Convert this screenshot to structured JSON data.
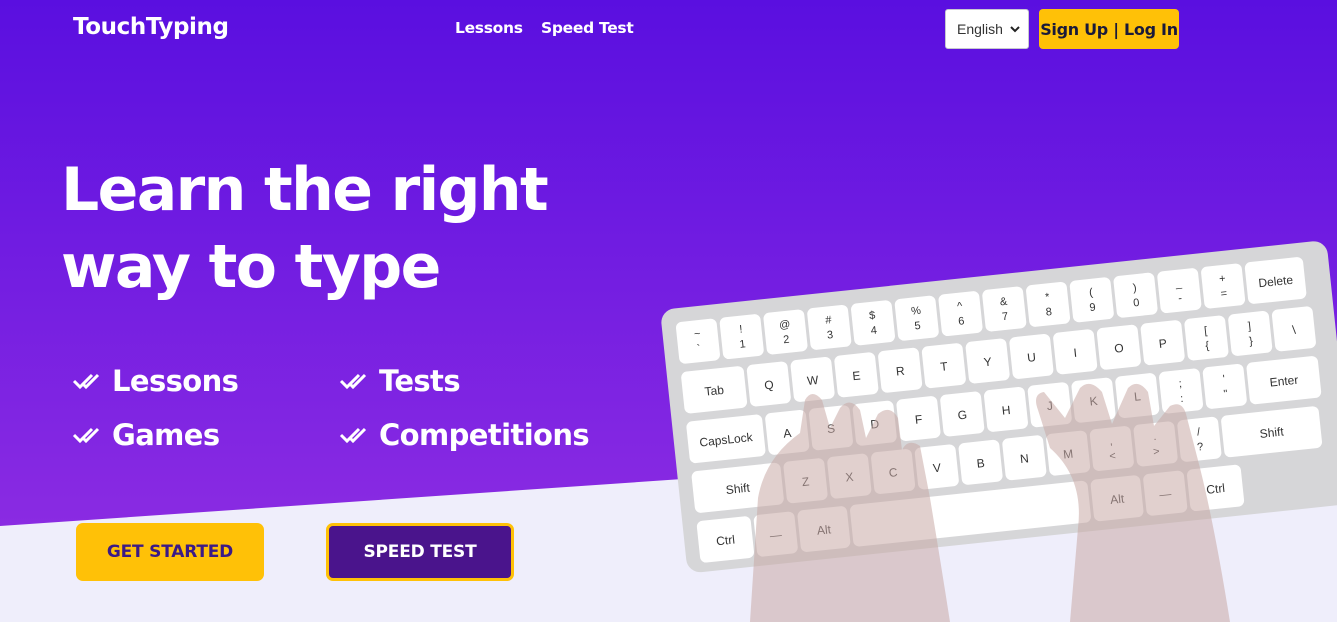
{
  "header": {
    "logo": "TouchTyping",
    "nav": [
      {
        "label": "Lessons"
      },
      {
        "label": "Speed Test"
      }
    ],
    "language": {
      "selected": "English"
    },
    "auth_label": "Sign Up | Log In"
  },
  "hero": {
    "headline_line1": "Learn the right",
    "headline_line2": "way to type",
    "features": [
      "Lessons",
      "Tests",
      "Games",
      "Competitions"
    ],
    "cta_primary": "GET STARTED",
    "cta_secondary": "SPEED TEST"
  },
  "keyboard": {
    "rows": [
      [
        "~|`",
        "!|1",
        "@|2",
        "#|3",
        "$|4",
        "%|5",
        "^|6",
        "&|7",
        "*|8",
        "(|9",
        ")|0",
        "_|-",
        "+|=",
        "Delete"
      ],
      [
        "Tab",
        "Q",
        "W",
        "E",
        "R",
        "T",
        "Y",
        "U",
        "I",
        "O",
        "P",
        "[|{",
        "]|}",
        "||\\"
      ],
      [
        "CapsLock",
        "A",
        "S",
        "D",
        "F",
        "G",
        "H",
        "J",
        "K",
        "L",
        ";|:",
        "'|\"",
        "Enter"
      ],
      [
        "Shift",
        "Z",
        "X",
        "C",
        "V",
        "B",
        "N",
        "M",
        ",|<",
        ".|>",
        "/|?",
        "Shift"
      ],
      [
        "Ctrl",
        "—",
        "Alt",
        "",
        "Alt",
        "—",
        "Ctrl"
      ]
    ]
  },
  "colors": {
    "gradient_top": "#5a0fe0",
    "gradient_bottom": "#8a2be2",
    "accent_yellow": "#ffc107",
    "secondary_button": "#4a148c",
    "lower_bg": "#efeefb"
  }
}
